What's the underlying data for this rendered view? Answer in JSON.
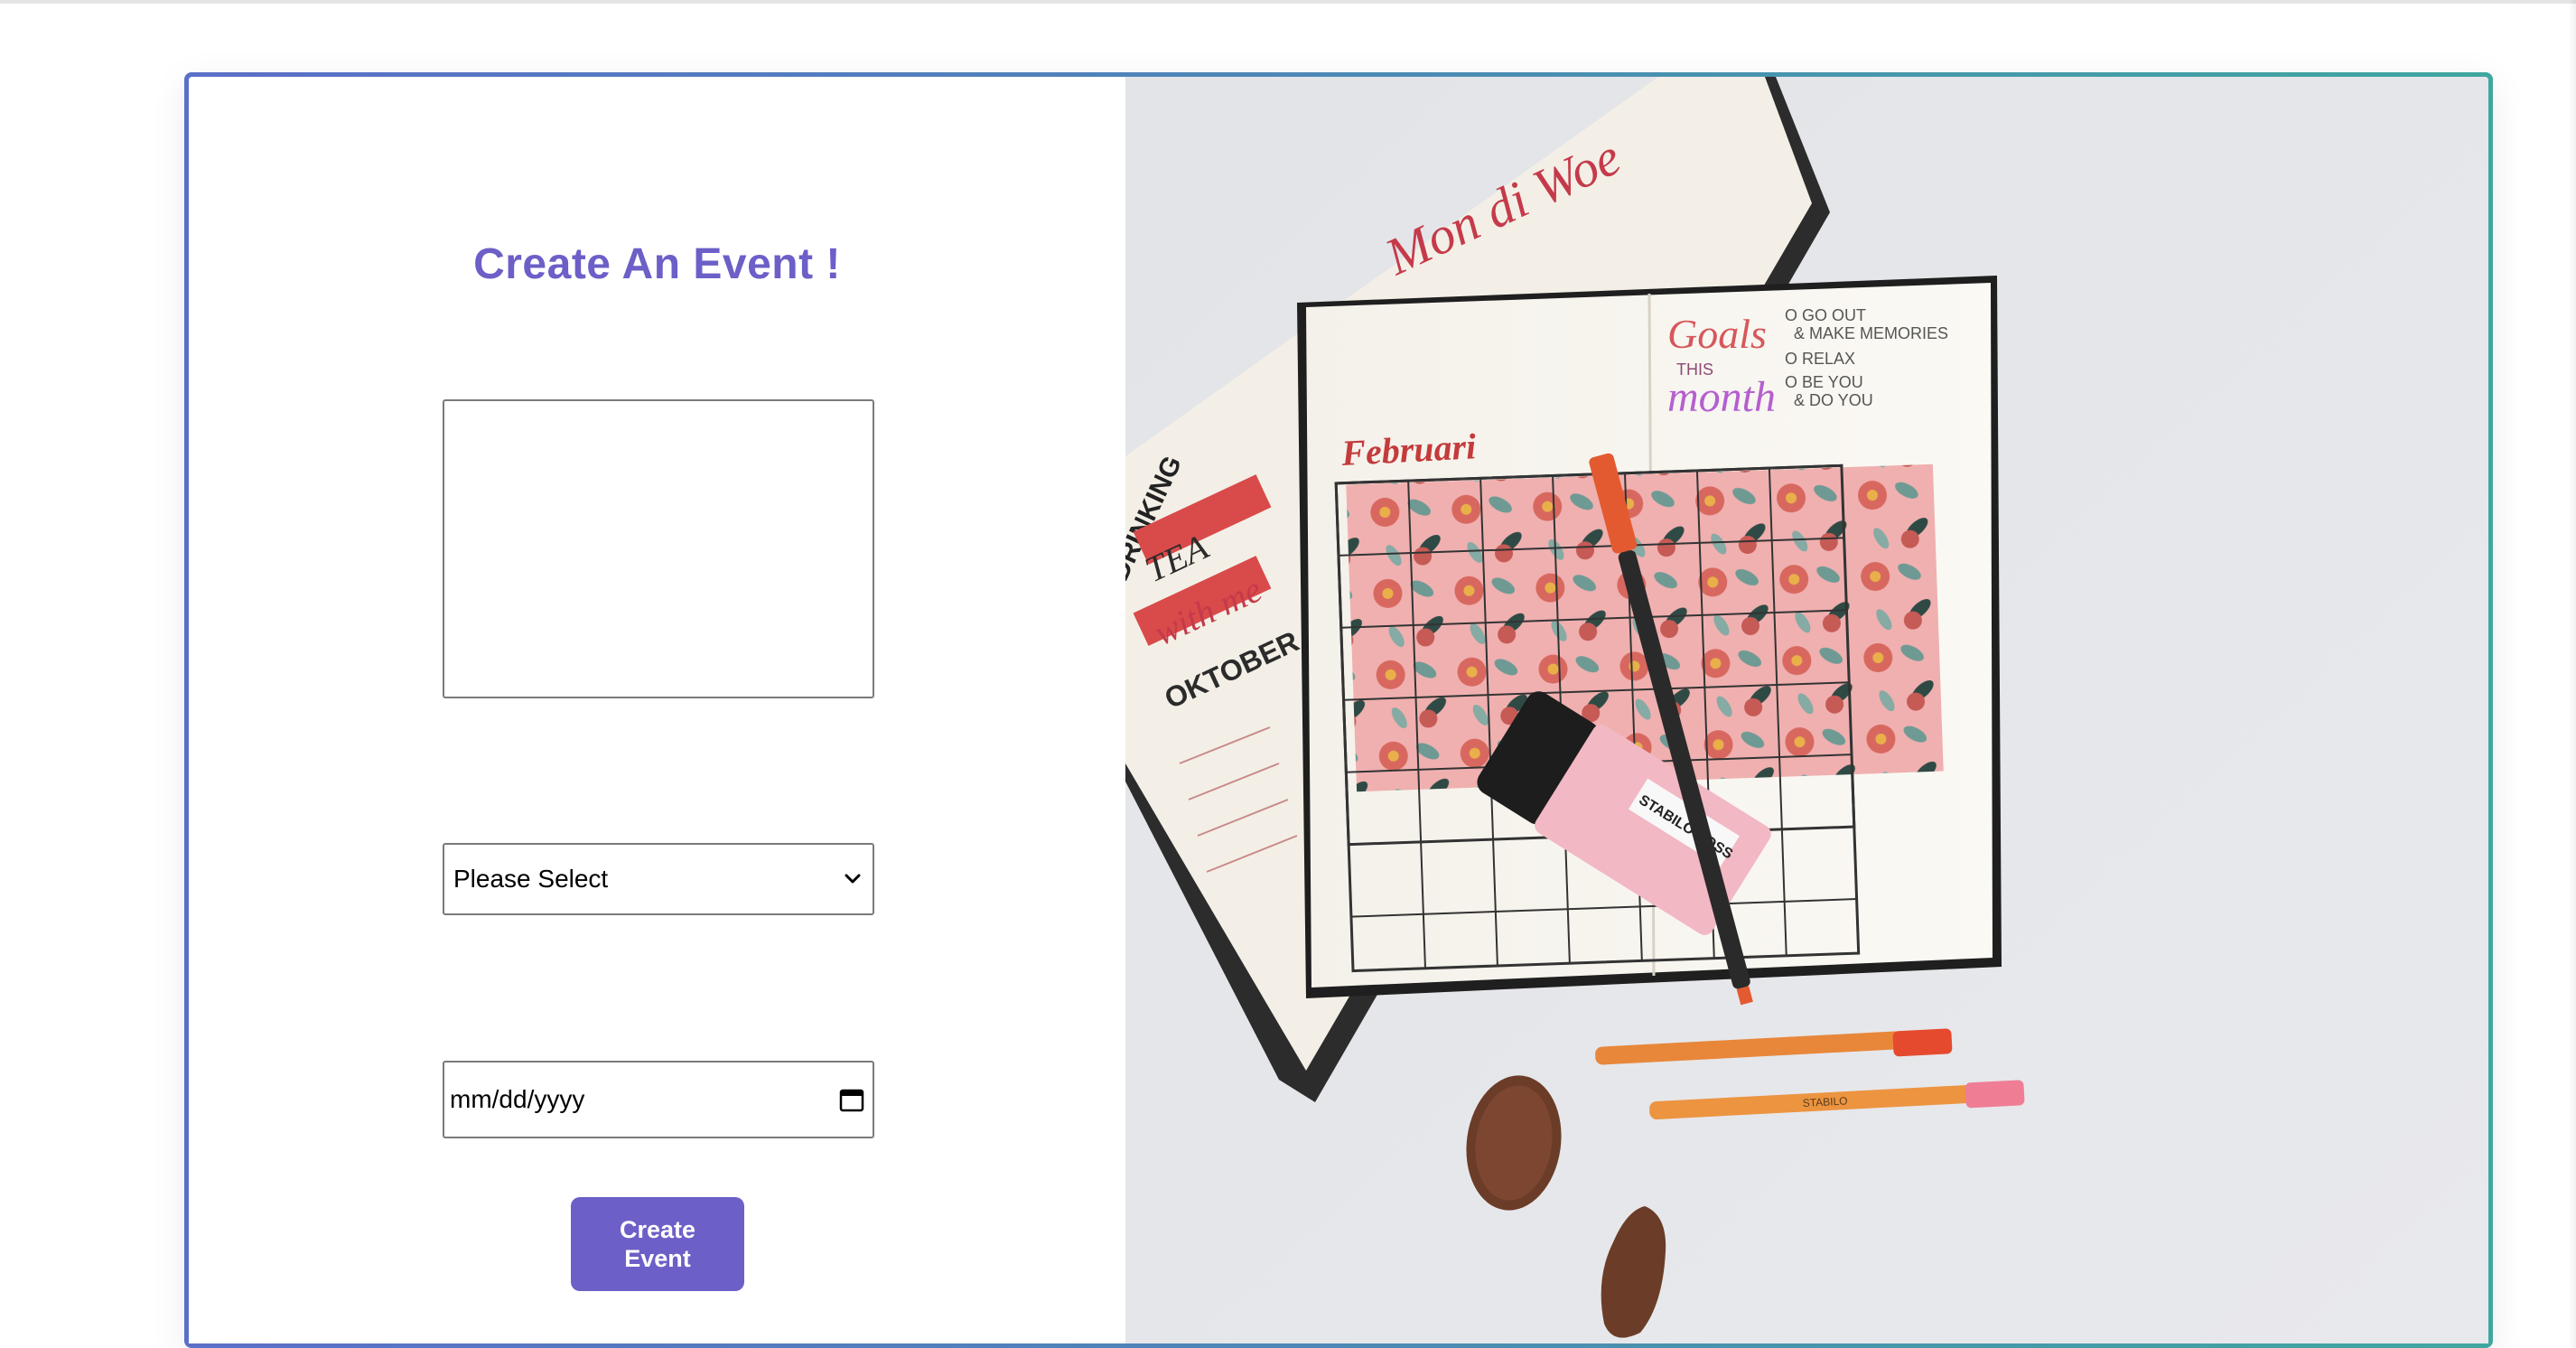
{
  "form": {
    "title": "Create An Event !",
    "description_value": "",
    "category_select": {
      "selected": "Please Select"
    },
    "date_input": {
      "placeholder": "mm/dd/yyyy"
    },
    "submit_label": "Create Event"
  },
  "hero_image": {
    "alt": "Bullet journal planner with highlighter pens and cookies",
    "handwriting": {
      "days_header": "Mon di Woe",
      "goals_title": "Goals",
      "goals_this": "THIS",
      "goals_month": "month",
      "goal_1": "O GO OUT",
      "goal_1b": "& MAKE MEMORIES",
      "goal_2": "O RELAX",
      "goal_3": "O BE YOU",
      "goal_3b": "& DO YOU",
      "month_label": "Februari",
      "drinking_label": "DRINKING",
      "tea_label": "TEA",
      "with_me_label": "with me",
      "oktober_label": "OKTOBER",
      "marker_brand": "STABILO BOSS",
      "pen_brand": "STABILO"
    }
  },
  "colors": {
    "accent": "#6c5fc7",
    "border_start": "#5b6fc8",
    "border_end": "#3fa7a0",
    "input_border": "#7a7a7a"
  },
  "icons": {
    "select_arrow": "chevron-down-icon",
    "date_picker": "calendar-icon"
  }
}
